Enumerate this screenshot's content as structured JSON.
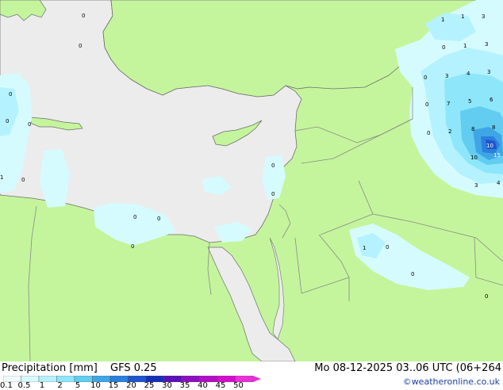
{
  "header": {
    "product": "Precipitation [mm]",
    "model": "GFS 0.25",
    "datetime": "Mo 08-12-2025 03..06 UTC (06+264"
  },
  "credit": "©weatheronline.co.uk",
  "legend": {
    "labels": [
      "0.1",
      "0.5",
      "1",
      "2",
      "5",
      "10",
      "15",
      "20",
      "25",
      "30",
      "35",
      "40",
      "45",
      "50"
    ],
    "colors": [
      "#f2ffff",
      "#d6fbff",
      "#b4f2ff",
      "#8ee6fa",
      "#62cdf0",
      "#3fa6e6",
      "#2b7fdd",
      "#1d55cc",
      "#1530b5",
      "#5a10b8",
      "#8a10c0",
      "#b20fc6",
      "#d40fcc",
      "#ea30d8"
    ]
  },
  "map": {
    "colors": {
      "sea": "#ececec",
      "land": "#c4f59c",
      "border": "#8a8a8a",
      "coast": "#6e6e6e"
    },
    "values": [
      "0",
      "0",
      "0",
      "0",
      "0",
      "0",
      "1",
      "0",
      "0",
      "0",
      "0",
      "0",
      "1",
      "1",
      "3",
      "0",
      "1",
      "3",
      "0",
      "3",
      "4",
      "3",
      "0",
      "7",
      "5",
      "6",
      "0",
      "2",
      "8",
      "8",
      "10",
      "10",
      "15",
      "3",
      "4",
      "1",
      "0",
      "0",
      "0",
      "0"
    ]
  }
}
